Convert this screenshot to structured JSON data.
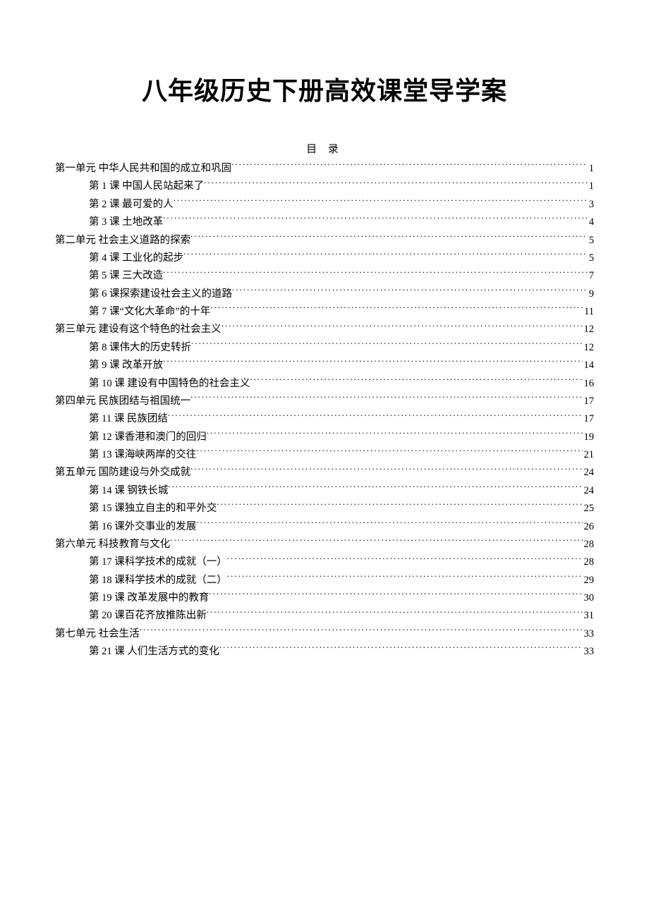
{
  "title": "八年级历史下册高效课堂导学案",
  "tocHeading": "目  录",
  "toc": [
    {
      "level": "unit",
      "label": "第一单元 中华人民共和国的成立和巩固",
      "page": "1"
    },
    {
      "level": "lesson",
      "label": "第 1 课 中国人民站起来了",
      "page": "1"
    },
    {
      "level": "lesson",
      "label": "第 2 课 最可爱的人",
      "page": "3"
    },
    {
      "level": "lesson",
      "label": "第 3 课 土地改革",
      "page": "4"
    },
    {
      "level": "unit",
      "label": "第二单元 社会主义道路的探索",
      "page": "5"
    },
    {
      "level": "lesson",
      "label": "第 4 课 工业化的起步",
      "page": "5"
    },
    {
      "level": "lesson",
      "label": "第 5 课 三大改造",
      "page": "7"
    },
    {
      "level": "lesson",
      "label": "第 6 课探索建设社会主义的道路",
      "page": "9"
    },
    {
      "level": "lesson",
      "label": "第 7 课“文化大革命”的十年",
      "page": "11"
    },
    {
      "level": "unit",
      "label": "第三单元 建设有这个特色的社会主义",
      "page": "12"
    },
    {
      "level": "lesson",
      "label": "第 8 课伟大的历史转折",
      "page": "12"
    },
    {
      "level": "lesson",
      "label": "第 9 课 改革开放",
      "page": "14"
    },
    {
      "level": "lesson",
      "label": "第 10 课 建设有中国特色的社会主义",
      "page": "16"
    },
    {
      "level": "unit",
      "label": "第四单元   民族团结与祖国统一",
      "page": "17"
    },
    {
      "level": "lesson",
      "label": "第 11 课 民族团结",
      "page": "17"
    },
    {
      "level": "lesson",
      "label": "第 12 课香港和澳门的回归",
      "page": "19"
    },
    {
      "level": "lesson",
      "label": "第 13 课海峡两岸的交往",
      "page": "21"
    },
    {
      "level": "unit",
      "label": "第五单元 国防建设与外交成就",
      "page": "24"
    },
    {
      "level": "lesson",
      "label": "第 14 课 钢铁长城",
      "page": "24"
    },
    {
      "level": "lesson",
      "label": "第 15 课独立自主的和平外交",
      "page": "25"
    },
    {
      "level": "lesson",
      "label": "第 16 课外交事业的发展",
      "page": "26"
    },
    {
      "level": "unit",
      "label": "第六单元 科技教育与文化",
      "page": "28"
    },
    {
      "level": "lesson",
      "label": "第 17 课科学技术的成就（一）",
      "page": "28"
    },
    {
      "level": "lesson",
      "label": "第 18 课科学技术的成就（二）",
      "page": "29"
    },
    {
      "level": "lesson",
      "label": "第 19 课 改革发展中的教育",
      "page": "30"
    },
    {
      "level": "lesson",
      "label": "第 20 课百花齐放推陈出新",
      "page": "31"
    },
    {
      "level": "unit",
      "label": "第七单元 社会生活",
      "page": "33"
    },
    {
      "level": "lesson",
      "label": "第 21 课 人们生活方式的变化",
      "page": "33"
    }
  ]
}
